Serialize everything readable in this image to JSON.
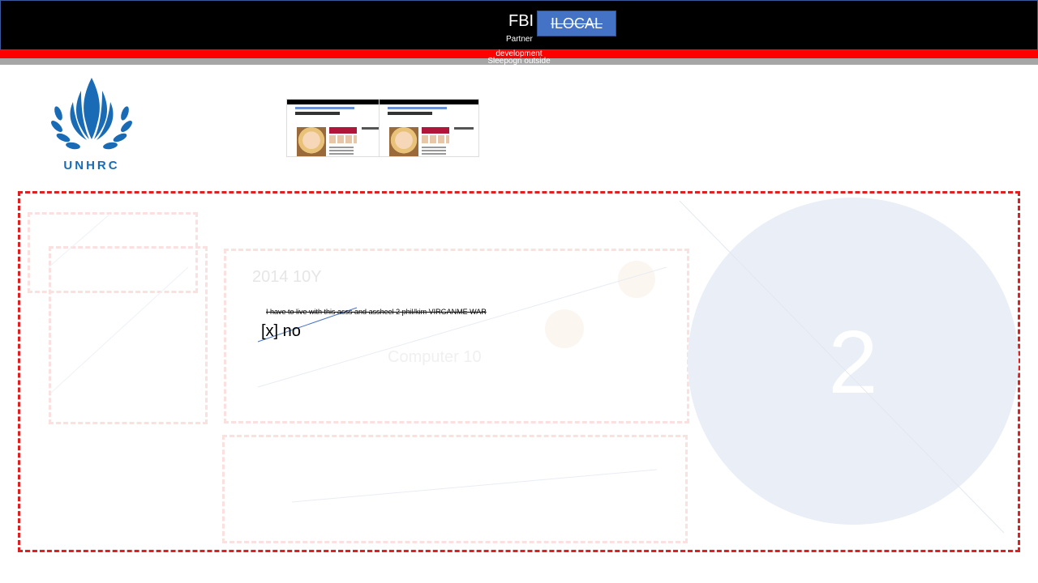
{
  "header": {
    "title": "FBI",
    "subtitle": "Partner",
    "button_label": "ILOCAL"
  },
  "banners": {
    "red": "development",
    "gray": "Sleepogn outside"
  },
  "logo": {
    "text": "UNHRC"
  },
  "slide": {
    "year": "2014 10Y",
    "note": "I have to live with this asss and assheel 2 phil/kim VIRGANME WAR",
    "checkbox": "[x] no",
    "computer": "Computer 10",
    "big_number": "2"
  },
  "colors": {
    "accent": "#4472c4",
    "banner_red": "#ff0000",
    "frame_red": "#e02020",
    "logo_blue": "#1a6bb5"
  }
}
